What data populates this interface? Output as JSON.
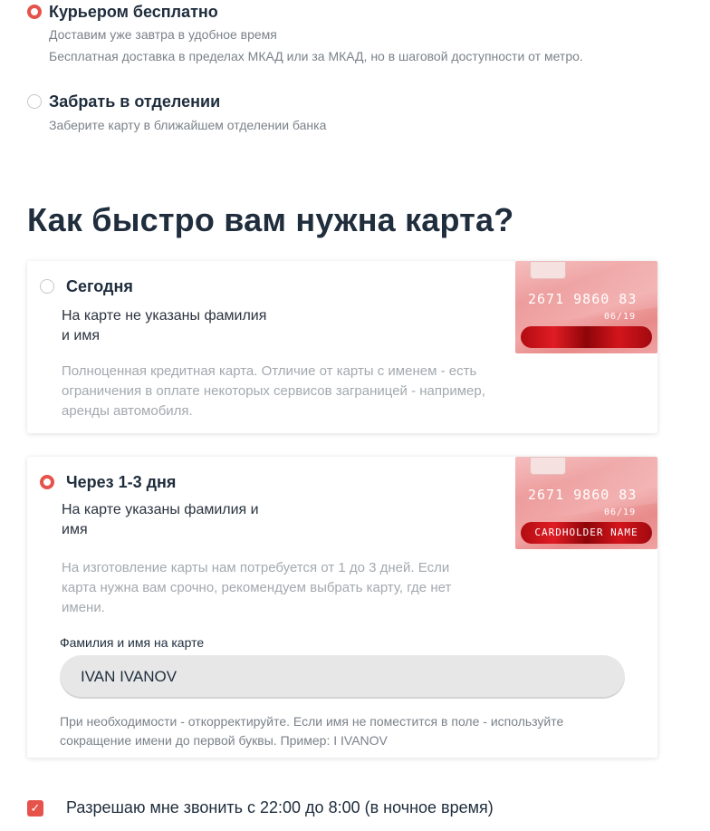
{
  "delivery": {
    "options": [
      {
        "title": "Курьером бесплатно",
        "line1": "Доставим уже завтра в удобное время",
        "line2": "Бесплатная доставка в пределах МКАД или за МКАД, но в шаговой доступности от метро.",
        "selected": true
      },
      {
        "title": "Забрать в отделении",
        "line1": "Заберите карту в ближайшем отделении банка",
        "selected": false
      }
    ]
  },
  "speed": {
    "heading": "Как быстро вам нужна карта?",
    "options": [
      {
        "title": "Сегодня",
        "lead": "На карте не указаны фамилия и имя",
        "description": "Полноценная кредитная карта. Отличие от карты с именем - есть ограничения в оплате некоторых сервисов заграницей - например, аренды автомобиля.",
        "card_number": "2671 9860 83",
        "card_expiry": "06/19",
        "card_strip_text": "",
        "selected": false
      },
      {
        "title": "Через 1-3 дня",
        "lead": "На карте указаны фамилия и имя",
        "description": "На изготовление карты нам потребуется от 1 до 3 дней. Если карта нужна вам срочно, рекомендуем выбрать карту, где нет имени.",
        "card_number": "2671 9860 83",
        "card_expiry": "06/19",
        "card_strip_text": "CARDHOLDER NAME",
        "selected": true,
        "name_field": {
          "label": "Фамилия и имя на карте",
          "value": "IVAN IVANOV",
          "help": "При необходимости - откорректируйте. Если имя не поместится в поле - используйте сокращение имени до первой буквы. Пример: I IVANOV"
        }
      }
    ]
  },
  "night_call": {
    "label": "Разрешаю мне звонить с 22:00 до 8:00 (в ночное время)",
    "checked": true
  },
  "colors": {
    "accent": "#e5534b",
    "text": "#1f2d3d",
    "muted": "#7b8289"
  }
}
